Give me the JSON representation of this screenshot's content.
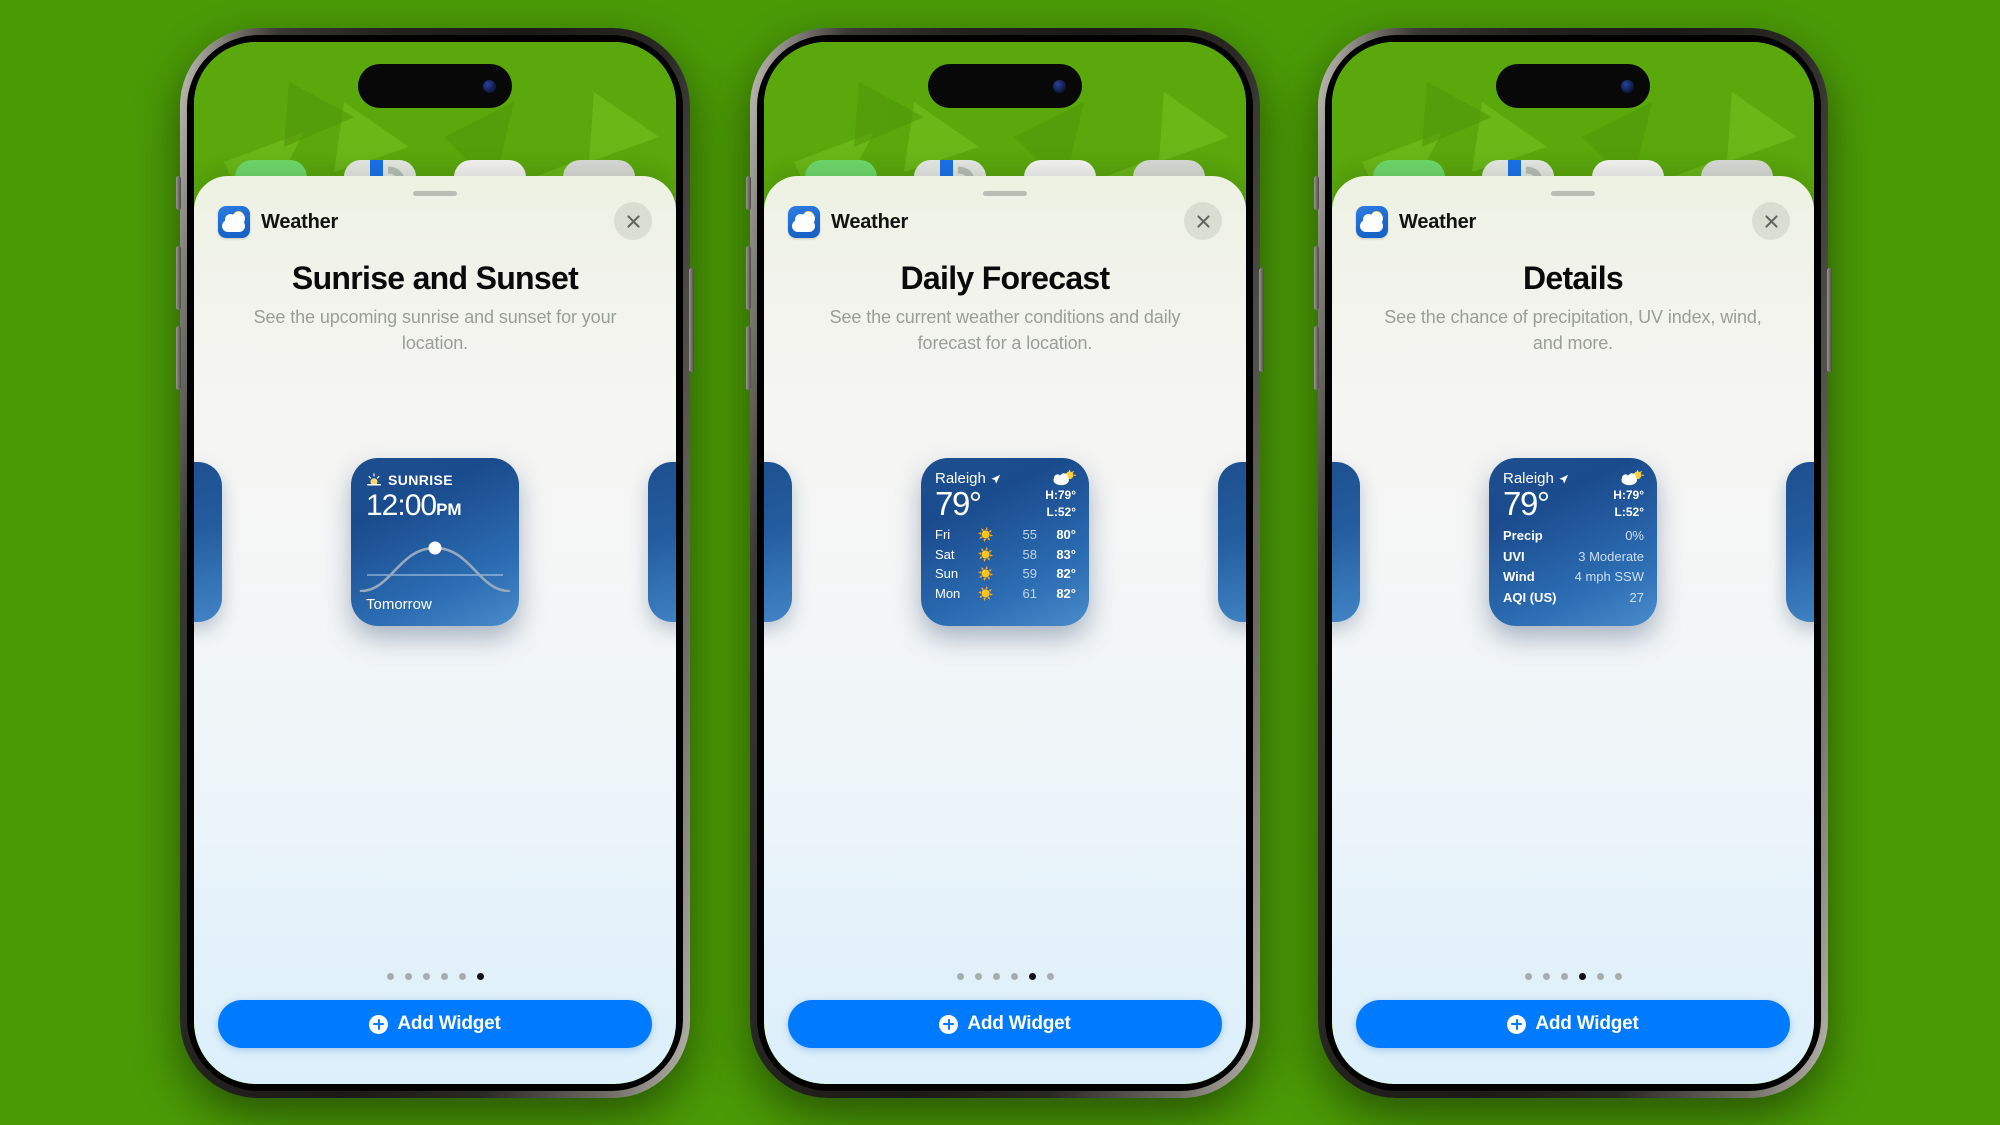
{
  "theme": {
    "background_color": "#4a9a06",
    "accent_color": "#007aff",
    "widget_blue": "#1d4f8f",
    "sheet_top_color": "#edf2e2",
    "sheet_bottom_color": "#dcf0fb"
  },
  "app": {
    "name": "Weather",
    "icon": "weather-app-icon"
  },
  "close_icon": "close-icon",
  "add_button": {
    "label": "Add Widget",
    "icon": "plus-circle-icon"
  },
  "phones": [
    {
      "id": "phone-sunrise",
      "title": "Sunrise and Sunset",
      "subtitle": "See the upcoming sunrise and sunset for your location.",
      "dots": {
        "count": 6,
        "active": 6
      },
      "widget": {
        "kind": "sunrise",
        "label": "SUNRISE",
        "icon": "sunrise-icon",
        "time": "12:00",
        "meridiem": "PM",
        "footer": "Tomorrow"
      }
    },
    {
      "id": "phone-forecast",
      "title": "Daily Forecast",
      "subtitle": "See the current weather conditions and daily forecast for a location.",
      "dots": {
        "count": 6,
        "active": 5
      },
      "widget": {
        "kind": "forecast",
        "city": "Raleigh",
        "location_icon": "location-arrow-icon",
        "temperature": "79°",
        "condition_icon": "partly-cloudy-icon",
        "high": "H:79°",
        "low": "L:52°",
        "days": [
          {
            "day": "Fri",
            "icon": "sun-icon",
            "low": "55",
            "high": "80°"
          },
          {
            "day": "Sat",
            "icon": "sun-icon",
            "low": "58",
            "high": "83°"
          },
          {
            "day": "Sun",
            "icon": "sun-icon",
            "low": "59",
            "high": "82°"
          },
          {
            "day": "Mon",
            "icon": "sun-icon",
            "low": "61",
            "high": "82°"
          }
        ]
      }
    },
    {
      "id": "phone-details",
      "title": "Details",
      "subtitle": "See the chance of precipitation, UV index, wind, and more.",
      "dots": {
        "count": 6,
        "active": 4
      },
      "widget": {
        "kind": "details",
        "city": "Raleigh",
        "location_icon": "location-arrow-icon",
        "temperature": "79°",
        "condition_icon": "partly-cloudy-icon",
        "high": "H:79°",
        "low": "L:52°",
        "metrics": [
          {
            "key": "Precip",
            "value": "0%"
          },
          {
            "key": "UVI",
            "value": "3 Moderate"
          },
          {
            "key": "Wind",
            "value": "4 mph SSW"
          },
          {
            "key": "AQI (US)",
            "value": "27"
          }
        ]
      }
    }
  ]
}
